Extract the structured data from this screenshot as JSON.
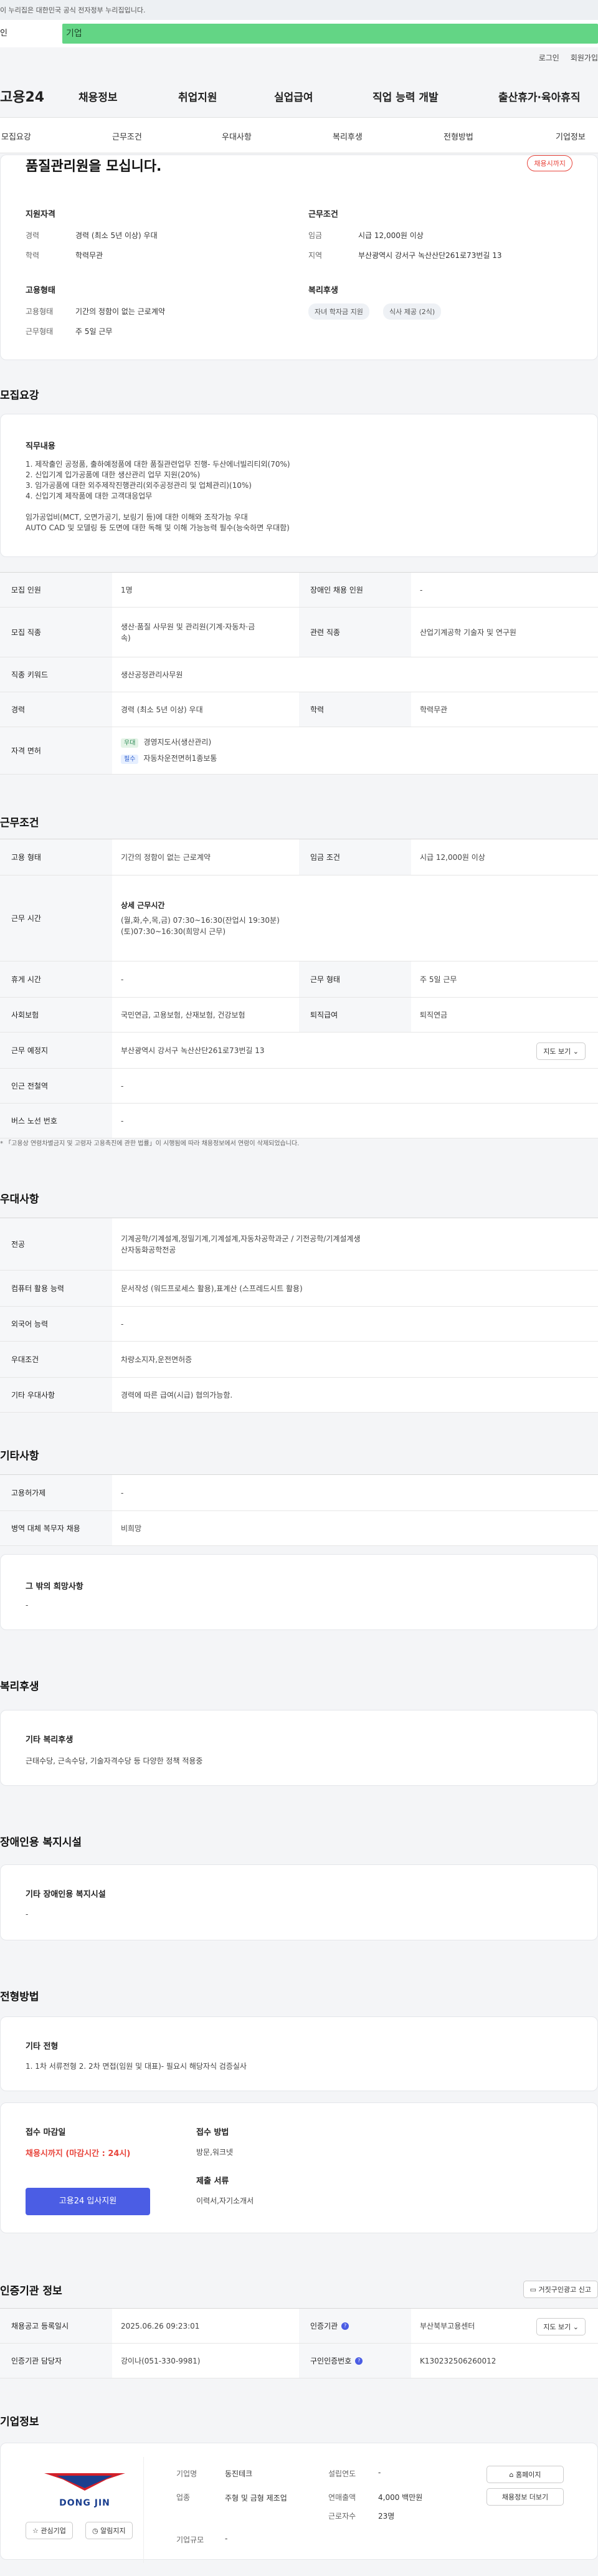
{
  "gov_notice": "이 누리집은 대한민국 공식 전자정부 누리집입니다.",
  "tabs": {
    "first": "인",
    "second": "기업"
  },
  "util": {
    "login": "로그인",
    "join": "회원가입"
  },
  "logo": "고용24",
  "gnb": [
    "채용정보",
    "취업지원",
    "실업급여",
    "직업 능력 개발",
    "출산휴가·육아휴직"
  ],
  "subnav": [
    "모집요강",
    "근무조건",
    "우대사항",
    "복리후생",
    "전형방법",
    "기업정보"
  ],
  "summary": {
    "headline": "품질관리원을 모십니다.",
    "badge": "채용시까지",
    "qual_title": "지원자격",
    "career_k": "경력",
    "career_v": "경력 (최소 5년 이상) 우대",
    "edu_k": "학력",
    "edu_v": "학력무관",
    "cond_title": "근무조건",
    "wage_k": "임금",
    "wage_v": "시급 12,000원 이상",
    "region_k": "지역",
    "region_v": "부산광역시 강서구 녹산산단261로73번길 13",
    "emp_title": "고용형태",
    "emptype_k": "고용형태",
    "emptype_v": "기간의 정함이 없는 근로계약",
    "worktype_k": "근무형태",
    "worktype_v": "주 5일 근무",
    "welfare_title": "복리후생",
    "chips": [
      "자녀 학자금 지원",
      "식사 제공 (2식)"
    ]
  },
  "recruit": {
    "section": "모집요강",
    "duty_title": "직무내용",
    "duty_lines": [
      "1. 제작출인 공정품, 출하예정품에 대한 품질관련업무 진행- 두산에너빌리티외(70%)",
      "2. 신입기계 입가공품에 대한 생산관리 업무 지원(20%)",
      "3. 임가공품에 대한 외주제작진행관리(외주공정관리 및 업체관리)(10%)",
      "4. 신입기계 제작품에 대한 고객대응업무",
      "",
      "임가공업비(MCT, 오면가공기, 보링기 등)에 대한 이해와 조작가능 우대",
      "AUTO CAD 및 모델링 등 도면에 대한 독해 및 이해 가능능력 필수(능숙하면 우대함)"
    ],
    "rows": [
      {
        "k1": "모집 인원",
        "v1": "1명",
        "k2": "장애인 채용 인원",
        "v2": "-"
      },
      {
        "k1": "모집 직종",
        "v1": "생산·품질 사무원 및 관리원(기계·자동차·금속)",
        "k2": "관련 직종",
        "v2": "산업기계공학 기술자 및 연구원"
      },
      {
        "k1": "직종 키워드",
        "v1": "생산공정관리사무원"
      },
      {
        "k1": "경력",
        "v1": "경력 (최소 5년 이상) 우대",
        "k2": "학력",
        "v2": "학력무관"
      }
    ],
    "license_k": "자격 면허",
    "license": [
      {
        "tag": "우대",
        "text": "경영지도사(생산관리)"
      },
      {
        "tag": "필수",
        "text": "자동차운전면허1종보통"
      }
    ]
  },
  "work": {
    "section": "근무조건",
    "rows": [
      {
        "k1": "고용 형태",
        "v1": "기간의 정함이 없는 근로계약",
        "k2": "임금 조건",
        "v2": "시급 12,000원 이상"
      }
    ],
    "time_k": "근무 시간",
    "time_title": "상세 근무시간",
    "time_lines": [
      "(월,화,수,목,금) 07:30~16:30(잔업시 19:30분)",
      "(토)07:30~16:30(희망시 근무)"
    ],
    "rows2": [
      {
        "k1": "휴게 시간",
        "v1": "-",
        "k2": "근무 형태",
        "v2": "주 5일 근무"
      },
      {
        "k1": "사회보험",
        "v1": "국민연금, 고용보험, 산재보험, 건강보험",
        "k2": "퇴직급여",
        "v2": "퇴직연금"
      }
    ],
    "place_k": "근무 예정지",
    "place_v": "부산광역시 강서구 녹산산단261로73번길 13",
    "map_btn": "지도 보기",
    "station_k": "인근 전철역",
    "station_v": "-",
    "bus_k": "버스 노선 번호",
    "bus_v": "-",
    "note": "* 「고용상 연령차별금지 및 고령자 고용촉진에 관한 법률」이 시행됨에 따라 채용정보에서 연령이 삭제되었습니다."
  },
  "pref": {
    "section": "우대사항",
    "rows": [
      {
        "k": "전공",
        "v": "기계공학/기계설계,정밀기계,기계설계,자동차공학과군 / 기전공학/기계설계생산자동화공학전공"
      },
      {
        "k": "컴퓨터 활용 능력",
        "v": "문서작성 (워드프로세스 활용),표계산 (스프레드시트 활용)"
      },
      {
        "k": "외국어 능력",
        "v": "-"
      },
      {
        "k": "우대조건",
        "v": "차량소지자,운전면허증"
      },
      {
        "k": "기타 우대사항",
        "v": "경력에 따른 급여(시급) 협의가능함."
      }
    ]
  },
  "etc": {
    "section": "기타사항",
    "rows": [
      {
        "k": "고용허가제",
        "v": "-"
      },
      {
        "k": "병역 대체 복무자 채용",
        "v": "비희망"
      }
    ],
    "other_title": "그 밖의 희망사항",
    "other_v": "-"
  },
  "welfare": {
    "section": "복리후생",
    "box_title": "기타 복리후생",
    "box_v": "근태수당, 근속수당, 기술자격수당 등 다양한 정책 적용중"
  },
  "disability": {
    "section": "장애인용 복지시설",
    "box_title": "기타 장애인용 복지시설",
    "box_v": "-"
  },
  "process": {
    "section": "전형방법",
    "box_title": "기타 전형",
    "box_v": "1. 1차 서류전형 2. 2차 면접(임원 및 대표)- 필요시 해당자식 검증실사",
    "deadline_title": "접수 마감일",
    "deadline_v": "채용시까지 (마감시간 : 24시)",
    "apply": "고용24 입사지원",
    "method_title": "접수 방법",
    "method_v": "방문,워크넷",
    "docs_title": "제출 서류",
    "docs_v": "이력서,자기소개서"
  },
  "cert": {
    "section": "인증기관 정보",
    "report_btn": "거짓구인광고 신고",
    "rows": [
      {
        "k1": "채용공고 등록일시",
        "v1": "2025.06.26 09:23:01",
        "k2": "인증기관",
        "v2": "부산북부고용센터",
        "btn": "지도 보기"
      },
      {
        "k1": "인증기관 담당자",
        "v1": "강이나(051-330-9981)",
        "k2": "구인인증번호",
        "v2": "K130232506260012"
      }
    ]
  },
  "company": {
    "section": "기업정보",
    "logo_text": "DONG JIN",
    "btn_interest": "관심기업",
    "btn_subscribe": "알림지지",
    "k_name": "기업명",
    "v_name": "동진테크",
    "k_industry": "업종",
    "v_industry": "주형 및 금형 제조업",
    "k_scale": "기업규모",
    "v_scale": "-",
    "k_founded": "설립연도",
    "v_founded": "-",
    "k_revenue": "연매출액",
    "v_revenue": "4,000 백만원",
    "k_staff": "근로자수",
    "v_staff": "23명",
    "btn_home": "홈페이지",
    "btn_more": "채용정보 더보기"
  }
}
